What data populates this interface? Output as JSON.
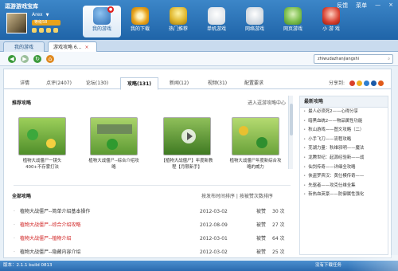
{
  "app_title": "逗游游戏宝库",
  "window_buttons": [
    "反馈",
    "菜单"
  ],
  "user": {
    "name": "Arex",
    "level": "等级58",
    "caret": "▼"
  },
  "nav": [
    {
      "label": "我的游戏",
      "icon": "game-pad-icon",
      "badge": "",
      "color": "#3d7cc0"
    },
    {
      "label": "我的下载",
      "icon": "download-gear-icon",
      "badge": "",
      "color": "#e8a21a"
    },
    {
      "label": "热门推荐",
      "icon": "trophy-icon",
      "badge": "",
      "color": "#e0c040"
    },
    {
      "label": "单机游戏",
      "icon": "joystick-icon",
      "badge": "",
      "color": "#f0f0f0"
    },
    {
      "label": "网络游戏",
      "icon": "controller-icon",
      "badge": "",
      "color": "#f0f0f0"
    },
    {
      "label": "网页游戏",
      "icon": "web-game-icon",
      "badge": "",
      "color": "#7fc050"
    },
    {
      "label": "小 游 戏",
      "icon": "small-game-icon",
      "badge": "",
      "color": "#d84030"
    }
  ],
  "tabs": [
    {
      "label": "我的游戏"
    },
    {
      "label": "游戏攻略 6...",
      "close": "×"
    }
  ],
  "toolbar": {
    "address": "zhiwudazhanjiangshi",
    "buttons": [
      "back-arrow-icon",
      "forward-arrow-icon",
      "refresh-icon",
      "home-icon"
    ]
  },
  "page_tabs": [
    {
      "label": "详情"
    },
    {
      "label": "点评(2407)"
    },
    {
      "label": "论坛(130)"
    },
    {
      "label": "攻略(131)"
    },
    {
      "label": "新闻(12)"
    },
    {
      "label": "视频(31)"
    },
    {
      "label": "配置要求"
    }
  ],
  "share_label": "分享到:",
  "recommend": {
    "title": "推荐攻略",
    "link": "进入逗游攻略中心",
    "cards": [
      {
        "caption": "植物大战僵尸一镜头400+不存雾打法"
      },
      {
        "caption": "植物大战僵尸--综合介绍攻略"
      },
      {
        "caption": "【植物大战僵尸】年度新教程【月限新手】"
      },
      {
        "caption": "植物大战僵尸年度新综合攻略的威力"
      }
    ]
  },
  "all": {
    "title": "全部攻略",
    "sort": "按发布时间排序 | 按被赞次数排序",
    "rows": [
      {
        "title": "植物大战僵尸--简单介绍基本操作",
        "date": "2012-03-02",
        "vote": "被赞",
        "count": "30 次",
        "red": false
      },
      {
        "title": "植物大战僵尸--综合介绍攻略",
        "date": "2012-08-09",
        "vote": "被赞",
        "count": "27 次",
        "red": true
      },
      {
        "title": "植物大战僵尸--植物介绍",
        "date": "2012-03-01",
        "vote": "被赞",
        "count": "64 次",
        "red": true
      },
      {
        "title": "植物大战僵尸--隐藏内容介绍",
        "date": "2012-03-02",
        "vote": "被赞",
        "count": "25 次",
        "red": false
      }
    ]
  },
  "latest": {
    "title": "最新攻略",
    "items": [
      "最人必须死2——心得分享",
      "暗黑血统2——物品属性功能",
      "秋山游戏——图文攻略（二）",
      "小手飞刀——流程攻略",
      "芜湖力量：秋维邪明——魔法",
      "龙腾世纪：起源经验新——战",
      "仙剑传奇——详细全攻略",
      "侠盗罗宾汉：黄仕模传奇——",
      "先驱者——攻克仕维全集",
      "斩热血英豪——防御属性强化"
    ]
  },
  "status": {
    "version": "版本：2.1.1 build 0813",
    "message": "没有下载任务"
  }
}
